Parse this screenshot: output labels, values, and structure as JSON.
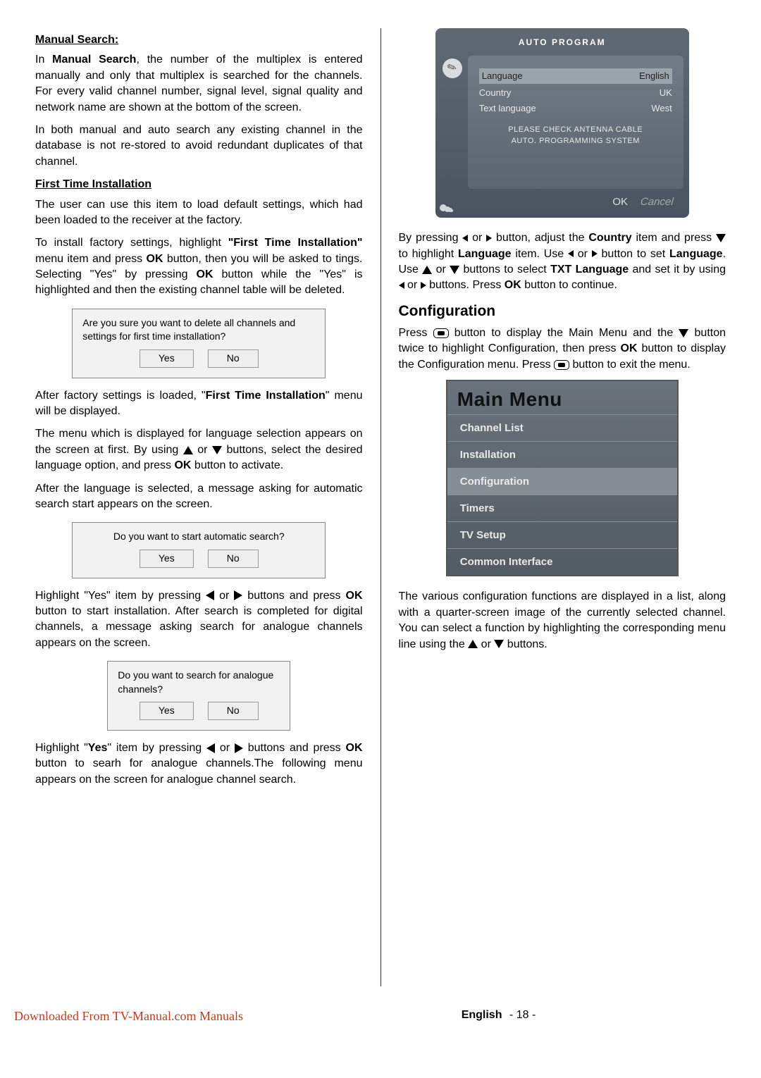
{
  "left": {
    "h_manual": "Manual Search:",
    "p_manual": [
      "In ",
      "Manual Search",
      ", the number of the multiplex is entered manually and only that multiplex is searched for the channels. For every valid channel number, signal level, signal quality and network name are shown at the bottom of the screen."
    ],
    "p_both": "In both manual and auto search any existing channel in the database is not re-stored to avoid redundant duplicates of that channel.",
    "h_first": "First Time Installation",
    "p_first1": "The user can use this item to load default settings, which had been loaded to the receiver at the factory.",
    "p_first2": [
      "To install factory settings, highlight ",
      "\"First Time Installation\"",
      " menu item and press ",
      "OK",
      " button, then you will be asked to tings. Selecting \"Yes\" by pressing ",
      "OK",
      " button while the \"Yes\" is highlighted and then the existing channel table will be deleted."
    ],
    "dlg1_txt": "Are you sure you want to delete all channels and settings for first time installation?",
    "yes": "Yes",
    "no": "No",
    "p_after1": [
      "After  factory settings is loaded, \"",
      "First Time Installation",
      "\" menu will be displayed."
    ],
    "p_lang": [
      "The menu which is displayed for language selection appears on the screen at first. By using ",
      " or ",
      " buttons, select the desired language option, and press ",
      "OK",
      " button to activate."
    ],
    "p_after_lang": "After the language is selected, a message asking for automatic search start appears on the screen.",
    "dlg2_txt": "Do you want to start automatic search?",
    "p_hl_yes1": [
      "Highlight \"Yes\" item by pressing ",
      " or ",
      " buttons and press ",
      "OK",
      " button to start installation. After search is completed for digital channels, a message asking search for analogue channels appears on the screen."
    ],
    "dlg3_txt": "Do you want to search for analogue channels?",
    "p_hl_yes2": [
      "Highlight \"",
      "Yes",
      "\" item by pressing ",
      " or ",
      " buttons and press ",
      "OK",
      " button to searh for analogue channels.The following menu appears on the screen for analogue channel search."
    ]
  },
  "right": {
    "auto": {
      "title": "AUTO PROGRAM",
      "rows": [
        {
          "k": "Language",
          "v": "English",
          "hl": true
        },
        {
          "k": "Country",
          "v": "UK"
        },
        {
          "k": "Text language",
          "v": "West"
        }
      ],
      "msg1": "PLEASE CHECK ANTENNA CABLE",
      "msg2": "AUTO. PROGRAMMING SYSTEM",
      "ok": "OK",
      "cancel": "Cancel"
    },
    "p_country": [
      "By pressing ",
      " or ",
      " button, adjust the ",
      "Country",
      " item and press ",
      " to highlight ",
      "Language",
      " item. Use ",
      " or ",
      " button to set  ",
      "Language",
      ". Use ",
      " or ",
      "  buttons to select ",
      "TXT Language",
      " and set it by using ",
      " or ",
      " buttons. Press ",
      "OK",
      " button to continue."
    ],
    "h_config": "Configuration",
    "p_config1": [
      "Press ",
      " button to display the Main Menu and the ",
      " button twice to highlight Configuration, then press ",
      "OK",
      " button to display the Configuration menu. Press ",
      " button to exit the menu."
    ],
    "menu_title": "Main Menu",
    "menu_items": [
      "Channel List",
      "Installation",
      "Configuration",
      "Timers",
      "TV Setup",
      "Common Interface"
    ],
    "p_config2": [
      "The various configuration functions are displayed in a list, along with a quarter-screen image of the currently selected channel. You can select a function by highlighting the corresponding menu line using the ",
      " or ",
      " buttons."
    ]
  },
  "footer": {
    "dl": "Downloaded From TV-Manual.com Manuals",
    "lang": "English",
    "page": "- 18 -"
  }
}
